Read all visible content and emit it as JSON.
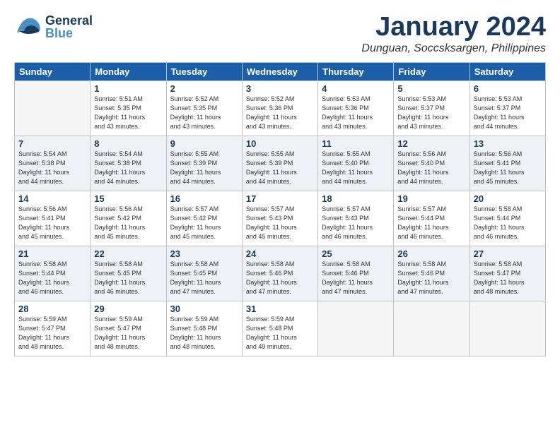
{
  "header": {
    "logo_general": "General",
    "logo_blue": "Blue",
    "month_title": "January 2024",
    "location": "Dunguan, Soccsksargen, Philippines"
  },
  "weekdays": [
    "Sunday",
    "Monday",
    "Tuesday",
    "Wednesday",
    "Thursday",
    "Friday",
    "Saturday"
  ],
  "weeks": [
    [
      {
        "day": "",
        "sunrise": "",
        "sunset": "",
        "daylight": ""
      },
      {
        "day": "1",
        "sunrise": "5:51 AM",
        "sunset": "5:35 PM",
        "hours": "11",
        "mins": "43"
      },
      {
        "day": "2",
        "sunrise": "5:52 AM",
        "sunset": "5:35 PM",
        "hours": "11",
        "mins": "43"
      },
      {
        "day": "3",
        "sunrise": "5:52 AM",
        "sunset": "5:36 PM",
        "hours": "11",
        "mins": "43"
      },
      {
        "day": "4",
        "sunrise": "5:53 AM",
        "sunset": "5:36 PM",
        "hours": "11",
        "mins": "43"
      },
      {
        "day": "5",
        "sunrise": "5:53 AM",
        "sunset": "5:37 PM",
        "hours": "11",
        "mins": "43"
      },
      {
        "day": "6",
        "sunrise": "5:53 AM",
        "sunset": "5:37 PM",
        "hours": "11",
        "mins": "44"
      }
    ],
    [
      {
        "day": "7",
        "sunrise": "5:54 AM",
        "sunset": "5:38 PM",
        "hours": "11",
        "mins": "44"
      },
      {
        "day": "8",
        "sunrise": "5:54 AM",
        "sunset": "5:38 PM",
        "hours": "11",
        "mins": "44"
      },
      {
        "day": "9",
        "sunrise": "5:55 AM",
        "sunset": "5:39 PM",
        "hours": "11",
        "mins": "44"
      },
      {
        "day": "10",
        "sunrise": "5:55 AM",
        "sunset": "5:39 PM",
        "hours": "11",
        "mins": "44"
      },
      {
        "day": "11",
        "sunrise": "5:55 AM",
        "sunset": "5:40 PM",
        "hours": "11",
        "mins": "44"
      },
      {
        "day": "12",
        "sunrise": "5:56 AM",
        "sunset": "5:40 PM",
        "hours": "11",
        "mins": "44"
      },
      {
        "day": "13",
        "sunrise": "5:56 AM",
        "sunset": "5:41 PM",
        "hours": "11",
        "mins": "45"
      }
    ],
    [
      {
        "day": "14",
        "sunrise": "5:56 AM",
        "sunset": "5:41 PM",
        "hours": "11",
        "mins": "45"
      },
      {
        "day": "15",
        "sunrise": "5:56 AM",
        "sunset": "5:42 PM",
        "hours": "11",
        "mins": "45"
      },
      {
        "day": "16",
        "sunrise": "5:57 AM",
        "sunset": "5:42 PM",
        "hours": "11",
        "mins": "45"
      },
      {
        "day": "17",
        "sunrise": "5:57 AM",
        "sunset": "5:43 PM",
        "hours": "11",
        "mins": "45"
      },
      {
        "day": "18",
        "sunrise": "5:57 AM",
        "sunset": "5:43 PM",
        "hours": "11",
        "mins": "46"
      },
      {
        "day": "19",
        "sunrise": "5:57 AM",
        "sunset": "5:44 PM",
        "hours": "11",
        "mins": "46"
      },
      {
        "day": "20",
        "sunrise": "5:58 AM",
        "sunset": "5:44 PM",
        "hours": "11",
        "mins": "46"
      }
    ],
    [
      {
        "day": "21",
        "sunrise": "5:58 AM",
        "sunset": "5:44 PM",
        "hours": "11",
        "mins": "46"
      },
      {
        "day": "22",
        "sunrise": "5:58 AM",
        "sunset": "5:45 PM",
        "hours": "11",
        "mins": "46"
      },
      {
        "day": "23",
        "sunrise": "5:58 AM",
        "sunset": "5:45 PM",
        "hours": "11",
        "mins": "47"
      },
      {
        "day": "24",
        "sunrise": "5:58 AM",
        "sunset": "5:46 PM",
        "hours": "11",
        "mins": "47"
      },
      {
        "day": "25",
        "sunrise": "5:58 AM",
        "sunset": "5:46 PM",
        "hours": "11",
        "mins": "47"
      },
      {
        "day": "26",
        "sunrise": "5:58 AM",
        "sunset": "5:46 PM",
        "hours": "11",
        "mins": "47"
      },
      {
        "day": "27",
        "sunrise": "5:58 AM",
        "sunset": "5:47 PM",
        "hours": "11",
        "mins": "48"
      }
    ],
    [
      {
        "day": "28",
        "sunrise": "5:59 AM",
        "sunset": "5:47 PM",
        "hours": "11",
        "mins": "48"
      },
      {
        "day": "29",
        "sunrise": "5:59 AM",
        "sunset": "5:47 PM",
        "hours": "11",
        "mins": "48"
      },
      {
        "day": "30",
        "sunrise": "5:59 AM",
        "sunset": "5:48 PM",
        "hours": "11",
        "mins": "48"
      },
      {
        "day": "31",
        "sunrise": "5:59 AM",
        "sunset": "5:48 PM",
        "hours": "11",
        "mins": "49"
      },
      {
        "day": "",
        "sunrise": "",
        "sunset": "",
        "daylight": ""
      },
      {
        "day": "",
        "sunrise": "",
        "sunset": "",
        "daylight": ""
      },
      {
        "day": "",
        "sunrise": "",
        "sunset": "",
        "daylight": ""
      }
    ]
  ]
}
